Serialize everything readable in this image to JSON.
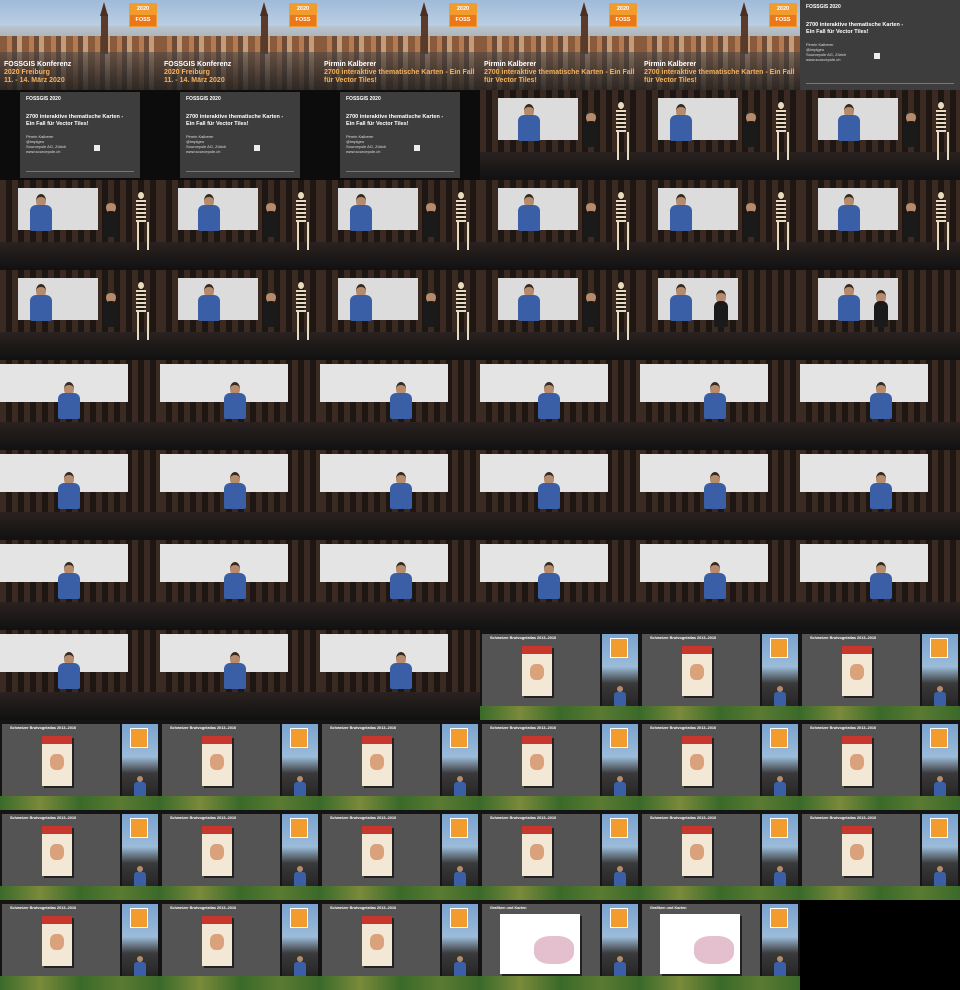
{
  "logo": {
    "year": "2020",
    "line1": "FOSS",
    "accent_color": "#f29b2f"
  },
  "captions": {
    "conference": {
      "line1": "FOSSGIS Konferenz",
      "line2": "2020 Freiburg",
      "line3": "11. - 14. März 2020"
    },
    "talk": {
      "line1": "Pirmin Kalberer",
      "line2": "2700 interaktive thematische Karten - Ein Fall",
      "line3": "für Vector Tiles!"
    }
  },
  "slide": {
    "header": "FOSSGIS 2020",
    "title": "2700 interaktive thematische Karten - Ein Fall für Vector Tiles!",
    "lines": [
      "Pirmin Kalberer",
      "@implgeo",
      "Sourcepole AG, Zürich",
      "www.sourcepole.ch"
    ]
  },
  "split_titles": {
    "atlas": "Schweizer Brutvogelatlas 2013–2016",
    "maps": "Grafiken und Karten"
  },
  "frames": [
    "title-conference",
    "title-conference",
    "title-talk-partial",
    "title-talk",
    "title-talk",
    "slide-full",
    "slide",
    "slide",
    "slide",
    "hall-skeleton",
    "hall-skeleton",
    "hall-skeleton",
    "hall-skeleton",
    "hall-skeleton",
    "hall-skeleton",
    "hall-skeleton",
    "hall-skeleton",
    "hall-skeleton",
    "hall-skeleton",
    "hall-skeleton",
    "hall-skeleton",
    "hall-skeleton",
    "hall-two",
    "hall-two",
    "lecture",
    "lecture",
    "lecture",
    "lecture",
    "lecture",
    "lecture",
    "lecture",
    "lecture",
    "lecture",
    "lecture",
    "lecture",
    "lecture",
    "lecture",
    "lecture",
    "lecture",
    "lecture",
    "lecture",
    "lecture",
    "lecture",
    "lecture",
    "lecture",
    "split-atlas",
    "split-atlas",
    "split-atlas",
    "split-atlas",
    "split-atlas",
    "split-atlas",
    "split-atlas",
    "split-atlas",
    "split-atlas",
    "split-atlas",
    "split-atlas",
    "split-atlas",
    "split-atlas",
    "split-atlas",
    "split-atlas",
    "split-atlas",
    "split-atlas",
    "split-atlas",
    "split-maps",
    "split-maps"
  ]
}
